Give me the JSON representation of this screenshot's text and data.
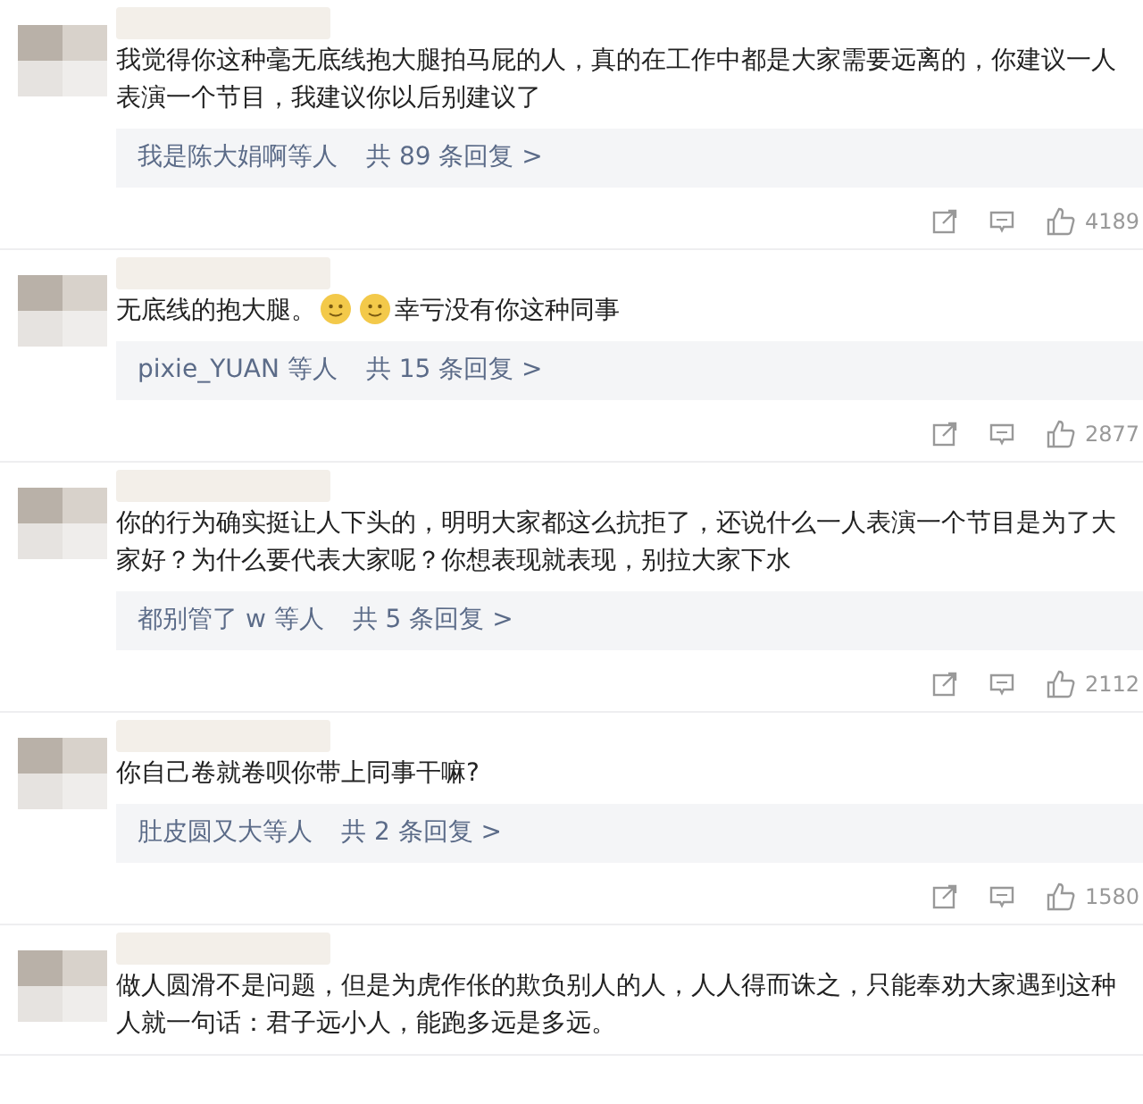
{
  "comments": [
    {
      "text": [
        {
          "kind": "text",
          "value": "我觉得你这种毫无底线抱大腿拍马屁的人，真的在工作中都是大家需要远离的，你建议一人表演一个节目，我建议你以后别建议了"
        }
      ],
      "reply_summary": {
        "users": "我是陈大娟啊等人",
        "count": "共 89 条回复 >"
      },
      "likes": "4189"
    },
    {
      "text": [
        {
          "kind": "text",
          "value": "无底线的抱大腿。"
        },
        {
          "kind": "emoji"
        },
        {
          "kind": "emoji"
        },
        {
          "kind": "text",
          "value": "幸亏没有你这种同事"
        }
      ],
      "reply_summary": {
        "users": "pixie_YUAN 等人",
        "count": "共 15 条回复 >"
      },
      "likes": "2877"
    },
    {
      "text": [
        {
          "kind": "text",
          "value": "你的行为确实挺让人下头的，明明大家都这么抗拒了，还说什么一人表演一个节目是为了大家好？为什么要代表大家呢？你想表现就表现，别拉大家下水"
        }
      ],
      "reply_summary": {
        "users": "都别管了 w 等人",
        "count": "共 5 条回复 >"
      },
      "likes": "2112"
    },
    {
      "text": [
        {
          "kind": "text",
          "value": "你自己卷就卷呗你带上同事干嘛?"
        }
      ],
      "reply_summary": {
        "users": "肚皮圆又大等人",
        "count": "共 2 条回复 >"
      },
      "likes": "1580"
    },
    {
      "text": [
        {
          "kind": "text",
          "value": "做人圆滑不是问题，但是为虎作伥的欺负别人的人，人人得而诛之，只能奉劝大家遇到这种人就一句话：君子远小人，能跑多远是多远。"
        }
      ]
    }
  ]
}
